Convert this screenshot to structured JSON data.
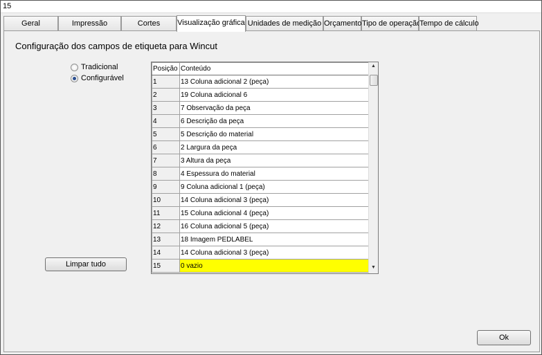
{
  "window": {
    "title": "15"
  },
  "tabs": [
    {
      "label": "Geral"
    },
    {
      "label": "Impressão"
    },
    {
      "label": "Cortes"
    },
    {
      "label": "Visualização gráfica"
    },
    {
      "label": "Unidades de medição"
    },
    {
      "label": "Orçamento"
    },
    {
      "label": "Tipo de operação"
    },
    {
      "label": "Tempo de cálculo"
    }
  ],
  "panel": {
    "heading": "Configuração dos campos de etiqueta para Wincut",
    "radio_tradicional": "Tradicional",
    "radio_configuravel": "Configurável",
    "selected_mode": "Configurável",
    "clear_button": "Limpar tudo",
    "ok_button": "Ok"
  },
  "grid": {
    "headers": {
      "position": "Posição",
      "content": "Conteúdo"
    },
    "rows": [
      {
        "pos": "1",
        "content": "13 Coluna adicional 2 (peça)"
      },
      {
        "pos": "2",
        "content": "19 Coluna adicional 6"
      },
      {
        "pos": "3",
        "content": "7  Observação da peça"
      },
      {
        "pos": "4",
        "content": "6  Descrição da peça"
      },
      {
        "pos": "5",
        "content": "5  Descrição do material"
      },
      {
        "pos": "6",
        "content": "2  Largura da peça"
      },
      {
        "pos": "7",
        "content": "3  Altura da peça"
      },
      {
        "pos": "8",
        "content": "4  Espessura do material"
      },
      {
        "pos": "9",
        "content": "9  Coluna adicional 1 (peça)"
      },
      {
        "pos": "10",
        "content": "14 Coluna adicional 3 (peça)"
      },
      {
        "pos": "11",
        "content": "15 Coluna adicional 4 (peça)"
      },
      {
        "pos": "12",
        "content": "16 Coluna adicional 5 (peça)"
      },
      {
        "pos": "13",
        "content": "18 Imagem PEDLABEL"
      },
      {
        "pos": "14",
        "content": "14 Coluna adicional 3 (peça)"
      },
      {
        "pos": "15",
        "content": "0  vazio"
      }
    ],
    "selected_row": "15",
    "highlight_color": "#ffff00"
  }
}
